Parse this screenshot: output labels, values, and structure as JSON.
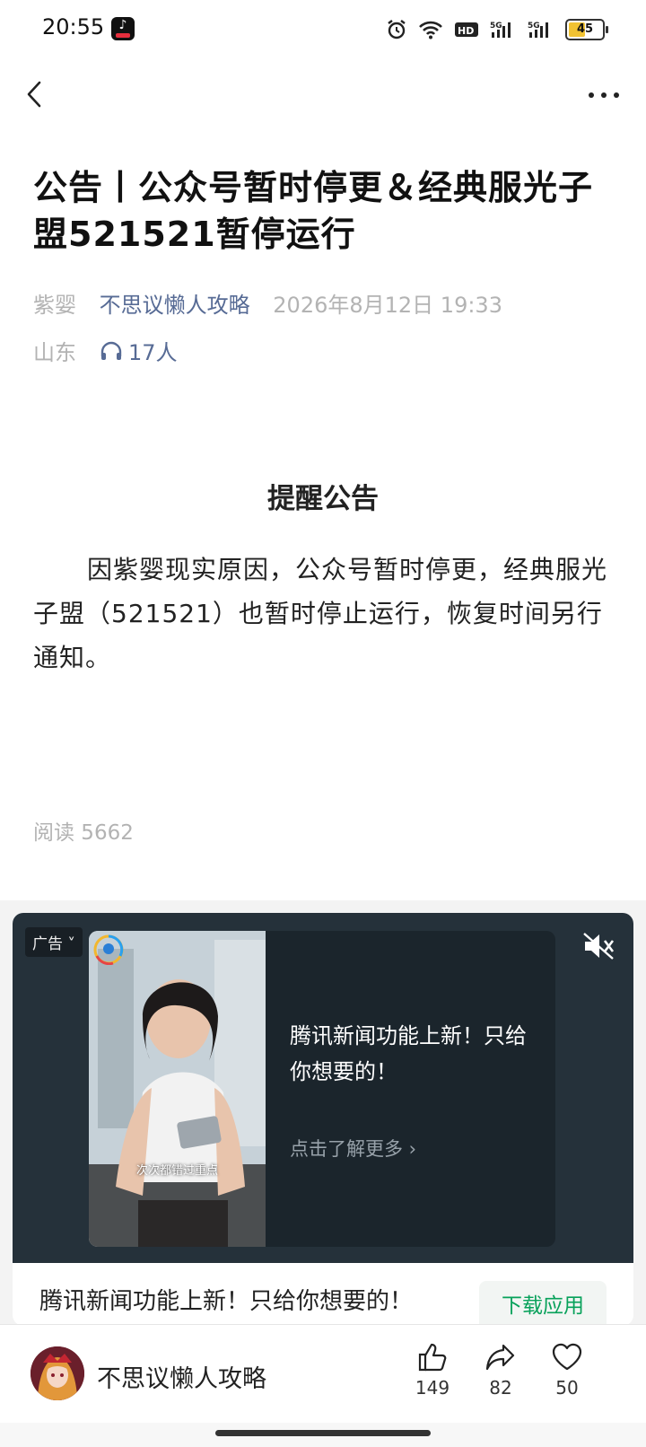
{
  "status_bar": {
    "time": "20:55",
    "battery": "45"
  },
  "article": {
    "title": "公告丨公众号暂时停更＆经典服光子盟521521暂停运行",
    "author": "紫婴",
    "account_name": "不思议懒人攻略",
    "datetime": "2026年8月12日 19:33",
    "location": "山东",
    "listeners": "17人",
    "section_heading": "提醒公告",
    "body": "因紫婴现实原因，公众号暂时停更，经典服光子盟（521521）也暂时停止运行，恢复时间另行通知。",
    "read_count": "阅读 5662"
  },
  "ad": {
    "label": "广告",
    "subtitle_overlay": "次次都错过重点",
    "headline": "腾讯新闻功能上新！只给你想要的！",
    "cta": "点击了解更多",
    "bottom_title": "腾讯新闻功能上新！只给你想要的！",
    "download_label": "下载应用"
  },
  "bottom_bar": {
    "account_name": "不思议懒人攻略",
    "like_count": "149",
    "share_count": "82",
    "favorite_count": "50"
  }
}
